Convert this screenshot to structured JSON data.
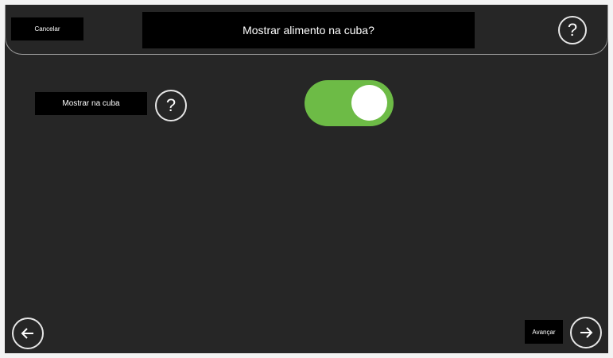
{
  "header": {
    "cancel_label": "Cancelar",
    "title": "Mostrar alimento na cuba?",
    "help_glyph": "?"
  },
  "setting": {
    "label": "Mostrar na cuba",
    "help_glyph": "?",
    "toggle_on": true
  },
  "footer": {
    "next_label": "Avançar"
  },
  "icons": {
    "help": "question-mark-icon",
    "back": "arrow-left-icon",
    "next": "arrow-right-icon"
  },
  "colors": {
    "background": "#262626",
    "toggle_on": "#6dbb46",
    "label_bg": "#000000"
  }
}
